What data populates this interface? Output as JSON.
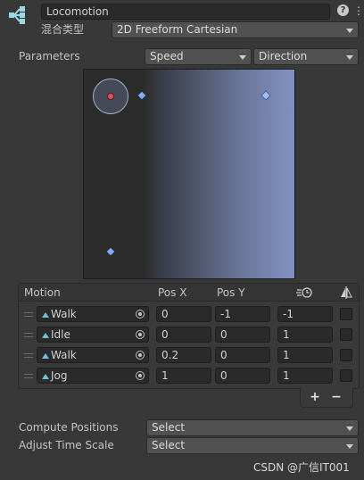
{
  "header": {
    "name_value": "Locomotion",
    "blend_type_label": "混合类型",
    "blend_type_value": "2D Freeform Cartesian"
  },
  "parameters": {
    "label": "Parameters",
    "param_x": "Speed",
    "param_y": "Direction"
  },
  "table": {
    "headers": {
      "motion": "Motion",
      "pos_x": "Pos X",
      "pos_y": "Pos Y"
    },
    "rows": [
      {
        "motion": "Walk",
        "pos_x": "0",
        "pos_y": "-1",
        "speed": "-1"
      },
      {
        "motion": "Idle",
        "pos_x": "0",
        "pos_y": "0",
        "speed": "1"
      },
      {
        "motion": "Walk",
        "pos_x": "0.2",
        "pos_y": "0",
        "speed": "1"
      },
      {
        "motion": "Jog",
        "pos_x": "1",
        "pos_y": "0",
        "speed": "1"
      }
    ],
    "add_label": "+",
    "remove_label": "−"
  },
  "settings": {
    "compute_positions_label": "Compute Positions",
    "compute_positions_value": "Select",
    "adjust_time_scale_label": "Adjust Time Scale",
    "adjust_time_scale_value": "Select"
  },
  "watermark": "CSDN @广信IT001",
  "icons": {
    "header": "blend-tree-icon",
    "help": "help-icon",
    "menu": "more-vertical-icon",
    "time": "time-icon",
    "mirror": "mirror-icon"
  },
  "colors": {
    "accent": "#6fc1d7",
    "point": "#7fb0ff",
    "current": "#e0505a"
  }
}
